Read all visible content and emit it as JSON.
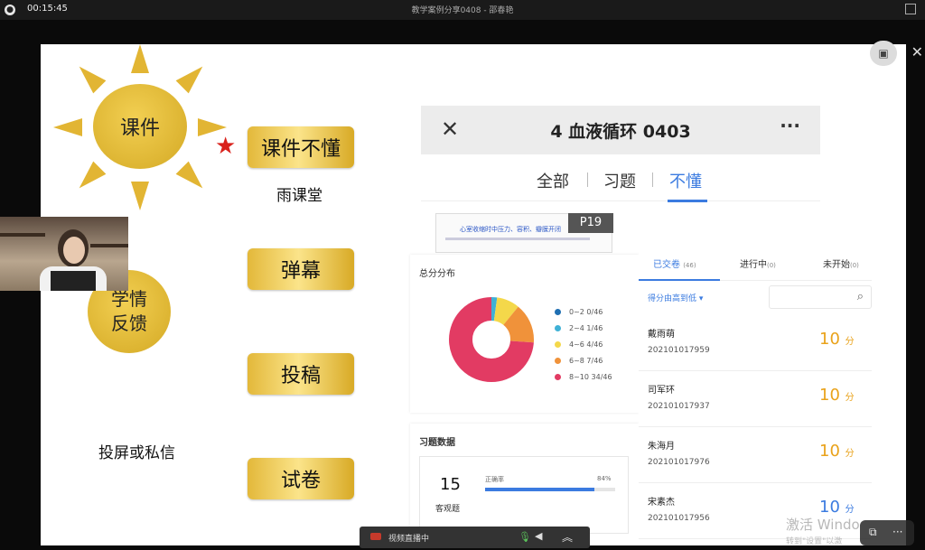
{
  "topbar": {
    "timer": "00:15:45",
    "title": "教学案例分享0408 - 邵春艳"
  },
  "slide": {
    "sun_large_label": "课件",
    "sun_small_label_line1": "学情",
    "sun_small_label_line2": "反馈",
    "btn_courseware": "课件不懂",
    "text_rain": "雨课堂",
    "btn_danmu": "弹幕",
    "btn_submit": "投稿",
    "text_cast": "投屏或私信",
    "btn_exam": "试卷"
  },
  "phone": {
    "title": "4 血液循环 0403",
    "tabs": [
      "全部",
      "习题",
      "不懂"
    ],
    "active_tab_index": 2,
    "thumb_text": "心室收缩时中压力、容积、瓣膜开闭",
    "page_badge": "P19"
  },
  "dist": {
    "title": "总分分布",
    "legend": [
      {
        "label": "0~2  0/46",
        "color": "#1f6fb2"
      },
      {
        "label": "2~4  1/46",
        "color": "#3fb1d6"
      },
      {
        "label": "4~6  4/46",
        "color": "#f4d84a"
      },
      {
        "label": "6~8  7/46",
        "color": "#f0923a"
      },
      {
        "label": "8~10  34/46",
        "color": "#e23b63"
      }
    ]
  },
  "chart_data": {
    "type": "pie",
    "categories": [
      "0~2",
      "2~4",
      "4~6",
      "6~8",
      "8~10"
    ],
    "values": [
      0,
      1,
      4,
      7,
      34
    ],
    "total": 46,
    "colors": [
      "#1f6fb2",
      "#3fb1d6",
      "#f4d84a",
      "#f0923a",
      "#e23b63"
    ]
  },
  "exercise": {
    "title": "习题数据",
    "count": "15",
    "count_label": "客观题",
    "rate_label": "正确率",
    "rate_text": "84%",
    "rate_value": 0.84
  },
  "list": {
    "tabs": [
      {
        "label": "已交卷",
        "count": "(46)"
      },
      {
        "label": "进行中",
        "count": "(0)"
      },
      {
        "label": "未开始",
        "count": "(0)"
      }
    ],
    "sort_label": "得分由高到低 ▾",
    "score_unit": "分",
    "students": [
      {
        "name": "戴雨萌",
        "id": "202101017959",
        "score": "10"
      },
      {
        "name": "司军环",
        "id": "202101017937",
        "score": "10"
      },
      {
        "name": "朱海月",
        "id": "202101017976",
        "score": "10"
      },
      {
        "name": "宋素杰",
        "id": "202101017956",
        "score": "10"
      }
    ]
  },
  "bottombar": {
    "live_label": "视频直播中"
  },
  "watermark": {
    "line1": "激活 Windo",
    "line2": "转到\"设置\"以激"
  }
}
